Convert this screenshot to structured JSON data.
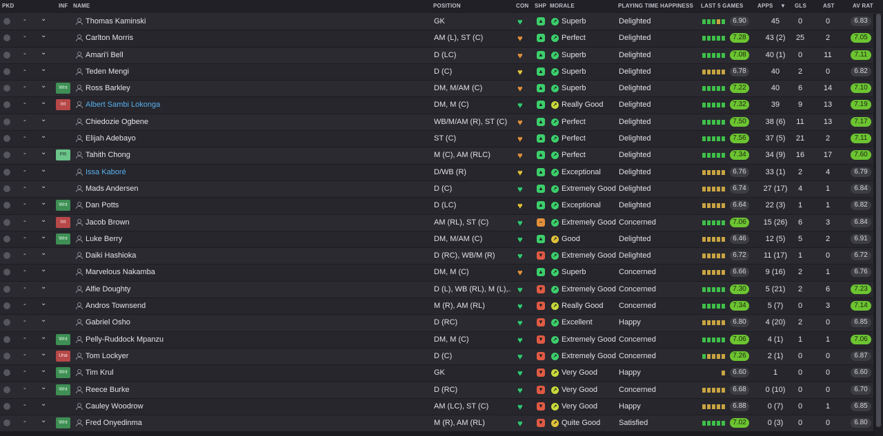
{
  "columns": {
    "pkd": "PKD",
    "inf": "INF",
    "name": "NAME",
    "position": "POSITION",
    "con": "CON",
    "shp": "SHP",
    "morale": "MORALE",
    "happiness": "PLAYING TIME HAPPINESS",
    "last5": "LAST 5 GAMES",
    "apps": "APPS",
    "gls": "GLS",
    "ast": "AST",
    "avrat": "AV RAT"
  },
  "sort_indicator": "▼",
  "dash": "-",
  "colors": {
    "green": "#2ecc71",
    "yellow": "#e0c33a",
    "orange": "#e2913a",
    "red": "#e05a44",
    "fill_bright": "#6cc431",
    "bar_green": "#3fc04a",
    "bar_gold": "#c9a443"
  },
  "players": [
    {
      "name": "Thomas Kaminski",
      "inf": "",
      "position": "GK",
      "con": "green",
      "shp": "up",
      "morale": "Superb",
      "happiness": "Delighted",
      "last5": [
        "g",
        "g",
        "g",
        "y",
        "g"
      ],
      "form": "6.90",
      "apps": "45",
      "gls": "0",
      "ast": "0",
      "avrat": "6.83"
    },
    {
      "name": "Carlton Morris",
      "inf": "",
      "position": "AM (L), ST (C)",
      "con": "orange",
      "shp": "up",
      "morale": "Perfect",
      "happiness": "Delighted",
      "last5": [
        "g",
        "g",
        "g",
        "g",
        "g"
      ],
      "form": "7.28",
      "apps": "43 (2)",
      "gls": "25",
      "ast": "2",
      "avrat": "7.05"
    },
    {
      "name": "Amari'i Bell",
      "inf": "",
      "position": "D (LC)",
      "con": "orange",
      "shp": "up",
      "morale": "Superb",
      "happiness": "Delighted",
      "last5": [
        "g",
        "g",
        "g",
        "g",
        "g"
      ],
      "form": "7.08",
      "apps": "40 (1)",
      "gls": "0",
      "ast": "11",
      "avrat": "7.11"
    },
    {
      "name": "Teden Mengi",
      "inf": "",
      "position": "D (C)",
      "con": "yellow",
      "shp": "up",
      "morale": "Superb",
      "happiness": "Delighted",
      "last5": [
        "y",
        "y",
        "y",
        "y",
        "y"
      ],
      "form": "6.78",
      "apps": "40",
      "gls": "2",
      "ast": "0",
      "avrat": "6.82"
    },
    {
      "name": "Ross Barkley",
      "inf": "Wnt",
      "position": "DM, M/AM (C)",
      "con": "orange",
      "shp": "up",
      "morale": "Superb",
      "happiness": "Delighted",
      "last5": [
        "g",
        "g",
        "g",
        "g",
        "g"
      ],
      "form": "7.22",
      "apps": "40",
      "gls": "6",
      "ast": "14",
      "avrat": "7.10"
    },
    {
      "name": "Albert Sambi Lokonga",
      "inf": "Int",
      "position": "DM, M (C)",
      "con": "green",
      "shp": "up",
      "morale": "Really Good",
      "happiness": "Delighted",
      "last5": [
        "g",
        "g",
        "g",
        "g",
        "g"
      ],
      "form": "7.32",
      "apps": "39",
      "gls": "9",
      "ast": "13",
      "avrat": "7.19"
    },
    {
      "name": "Chiedozie Ogbene",
      "inf": "",
      "position": "WB/M/AM (R), ST (C)",
      "con": "orange",
      "shp": "up",
      "morale": "Perfect",
      "happiness": "Delighted",
      "last5": [
        "g",
        "g",
        "g",
        "g",
        "g"
      ],
      "form": "7.50",
      "apps": "38 (6)",
      "gls": "11",
      "ast": "13",
      "avrat": "7.17"
    },
    {
      "name": "Elijah Adebayo",
      "inf": "",
      "position": "ST (C)",
      "con": "orange",
      "shp": "up",
      "morale": "Perfect",
      "happiness": "Delighted",
      "last5": [
        "g",
        "g",
        "g",
        "g",
        "g"
      ],
      "form": "7.56",
      "apps": "37 (5)",
      "gls": "21",
      "ast": "2",
      "avrat": "7.11"
    },
    {
      "name": "Tahith Chong",
      "inf": "PR",
      "position": "M (C), AM (RLC)",
      "con": "orange",
      "shp": "up",
      "morale": "Perfect",
      "happiness": "Delighted",
      "last5": [
        "g",
        "g",
        "g",
        "g",
        "g"
      ],
      "form": "7.34",
      "apps": "34 (9)",
      "gls": "16",
      "ast": "17",
      "avrat": "7.60"
    },
    {
      "name": "Issa Kaboré",
      "inf": "",
      "position": "D/WB (R)",
      "con": "yellow",
      "shp": "up",
      "morale": "Exceptional",
      "happiness": "Delighted",
      "last5": [
        "y",
        "y",
        "y",
        "y",
        "y"
      ],
      "form": "6.76",
      "apps": "33 (1)",
      "gls": "2",
      "ast": "4",
      "avrat": "6.79"
    },
    {
      "name": "Mads Andersen",
      "inf": "",
      "position": "D (C)",
      "con": "green",
      "shp": "up",
      "morale": "Extremely Good",
      "happiness": "Delighted",
      "last5": [
        "y",
        "y",
        "y",
        "y",
        "y"
      ],
      "form": "6.74",
      "apps": "27 (17)",
      "gls": "4",
      "ast": "1",
      "avrat": "6.84"
    },
    {
      "name": "Dan Potts",
      "inf": "Wnt",
      "position": "D (LC)",
      "con": "yellow",
      "shp": "up",
      "morale": "Exceptional",
      "happiness": "Delighted",
      "last5": [
        "y",
        "y",
        "y",
        "y",
        "y"
      ],
      "form": "6.64",
      "apps": "22 (3)",
      "gls": "1",
      "ast": "1",
      "avrat": "6.82"
    },
    {
      "name": "Jacob Brown",
      "inf": "Int",
      "position": "AM (RL), ST (C)",
      "con": "green",
      "shp": "minus",
      "morale": "Extremely Good",
      "happiness": "Concerned",
      "last5": [
        "g",
        "g",
        "g",
        "g",
        "g"
      ],
      "form": "7.06",
      "apps": "15 (26)",
      "gls": "6",
      "ast": "3",
      "avrat": "6.84"
    },
    {
      "name": "Luke Berry",
      "inf": "Wnt",
      "position": "DM, M/AM (C)",
      "con": "green",
      "shp": "up",
      "morale": "Good",
      "happiness": "Delighted",
      "last5": [
        "y",
        "y",
        "y",
        "y",
        "y"
      ],
      "form": "6.46",
      "apps": "12 (5)",
      "gls": "5",
      "ast": "2",
      "avrat": "6.91"
    },
    {
      "name": "Daiki Hashioka",
      "inf": "",
      "position": "D (RC), WB/M (R)",
      "con": "green",
      "shp": "down",
      "morale": "Extremely Good",
      "happiness": "Delighted",
      "last5": [
        "y",
        "y",
        "y",
        "y",
        "y"
      ],
      "form": "6.72",
      "apps": "11 (17)",
      "gls": "1",
      "ast": "0",
      "avrat": "6.72"
    },
    {
      "name": "Marvelous Nakamba",
      "inf": "",
      "position": "DM, M (C)",
      "con": "orange",
      "shp": "up",
      "morale": "Superb",
      "happiness": "Concerned",
      "last5": [
        "y",
        "y",
        "y",
        "y",
        "y"
      ],
      "form": "6.66",
      "apps": "9 (16)",
      "gls": "2",
      "ast": "1",
      "avrat": "6.76"
    },
    {
      "name": "Alfie Doughty",
      "inf": "",
      "position": "D (L), WB (RL), M (L),...",
      "con": "green",
      "shp": "down",
      "morale": "Extremely Good",
      "happiness": "Concerned",
      "last5": [
        "g",
        "g",
        "g",
        "g",
        "g"
      ],
      "form": "7.30",
      "apps": "5 (21)",
      "gls": "2",
      "ast": "6",
      "avrat": "7.23"
    },
    {
      "name": "Andros Townsend",
      "inf": "",
      "position": "M (R), AM (RL)",
      "con": "green",
      "shp": "down",
      "morale": "Really Good",
      "happiness": "Concerned",
      "last5": [
        "g",
        "g",
        "g",
        "g",
        "g"
      ],
      "form": "7.34",
      "apps": "5 (7)",
      "gls": "0",
      "ast": "3",
      "avrat": "7.14"
    },
    {
      "name": "Gabriel Osho",
      "inf": "",
      "position": "D (RC)",
      "con": "green",
      "shp": "down",
      "morale": "Excellent",
      "happiness": "Happy",
      "last5": [
        "y",
        "y",
        "y",
        "y",
        "y"
      ],
      "form": "6.80",
      "apps": "4 (20)",
      "gls": "2",
      "ast": "0",
      "avrat": "6.85"
    },
    {
      "name": "Pelly-Ruddock Mpanzu",
      "inf": "Wnt",
      "position": "DM, M (C)",
      "con": "green",
      "shp": "down",
      "morale": "Extremely Good",
      "happiness": "Concerned",
      "last5": [
        "g",
        "g",
        "g",
        "g",
        "g"
      ],
      "form": "7.06",
      "apps": "4 (1)",
      "gls": "1",
      "ast": "1",
      "avrat": "7.06"
    },
    {
      "name": "Tom Lockyer",
      "inf": "Una",
      "position": "D (C)",
      "con": "green",
      "shp": "down",
      "morale": "Extremely Good",
      "happiness": "Concerned",
      "last5": [
        "g",
        "y",
        "y",
        "y",
        "y"
      ],
      "form": "7.26",
      "apps": "2 (1)",
      "gls": "0",
      "ast": "0",
      "avrat": "6.87"
    },
    {
      "name": "Tim Krul",
      "inf": "Wnt",
      "position": "GK",
      "con": "green",
      "shp": "down",
      "morale": "Very Good",
      "happiness": "Happy",
      "last5": [
        "",
        "",
        "",
        "",
        "y"
      ],
      "form": "6.60",
      "apps": "1",
      "gls": "0",
      "ast": "0",
      "avrat": "6.60"
    },
    {
      "name": "Reece Burke",
      "inf": "Wnt",
      "position": "D (RC)",
      "con": "green",
      "shp": "down",
      "morale": "Very Good",
      "happiness": "Concerned",
      "last5": [
        "y",
        "y",
        "y",
        "y",
        "y"
      ],
      "form": "6.68",
      "apps": "0 (10)",
      "gls": "0",
      "ast": "0",
      "avrat": "6.70"
    },
    {
      "name": "Cauley Woodrow",
      "inf": "",
      "position": "AM (LC), ST (C)",
      "con": "green",
      "shp": "down",
      "morale": "Very Good",
      "happiness": "Happy",
      "last5": [
        "y",
        "y",
        "y",
        "y",
        "y"
      ],
      "form": "6.88",
      "apps": "0 (7)",
      "gls": "0",
      "ast": "1",
      "avrat": "6.85"
    },
    {
      "name": "Fred Onyedinma",
      "inf": "Wnt",
      "position": "M (R), AM (RL)",
      "con": "green",
      "shp": "down",
      "morale": "Quite Good",
      "happiness": "Satisfied",
      "last5": [
        "g",
        "g",
        "g",
        "g",
        "g"
      ],
      "form": "7.02",
      "apps": "0 (3)",
      "gls": "0",
      "ast": "0",
      "avrat": "6.80"
    }
  ]
}
